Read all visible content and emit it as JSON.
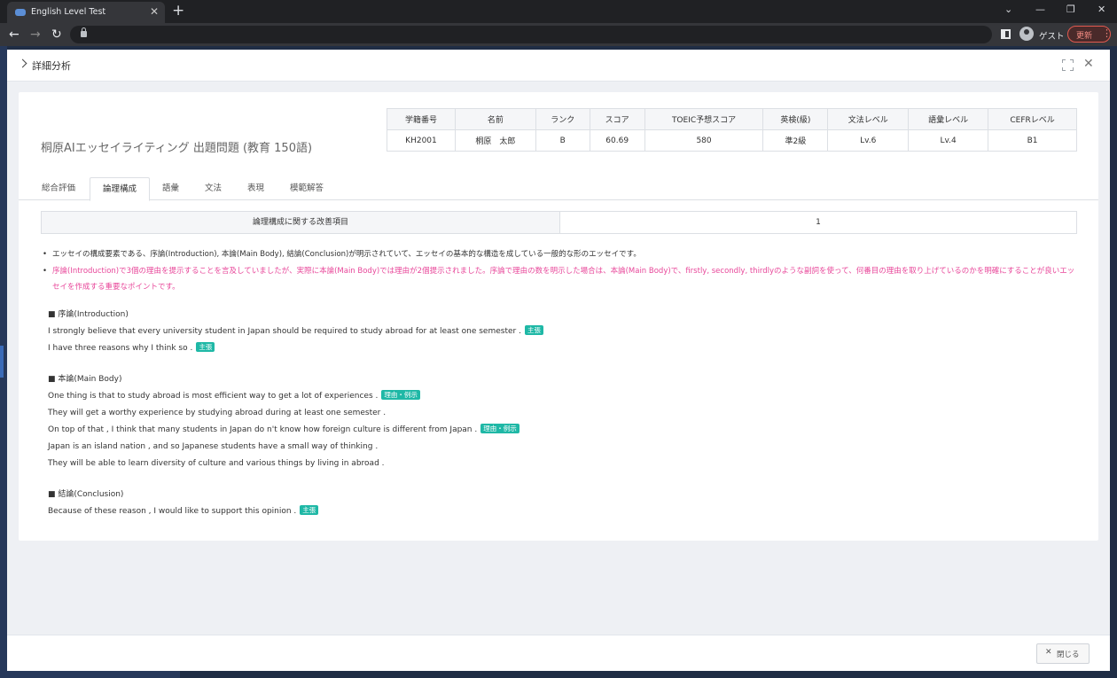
{
  "browser": {
    "tab_title": "English Level Test",
    "tab_close": "✕",
    "new_tab": "+",
    "window_controls": [
      "⌄",
      "—",
      "❐",
      "✕"
    ],
    "nav": {
      "back": "←",
      "forward": "→",
      "reload": "↻"
    },
    "profile_label": "ゲスト",
    "update_label": "更新",
    "update_menu": "⋮"
  },
  "modal": {
    "title": "詳細分析",
    "close_icon": "✕",
    "test_title": "桐原AIエッセイライティング 出題問題 (教育 150語)",
    "summary": {
      "headers": [
        "学籍番号",
        "名前",
        "ランク",
        "スコア",
        "TOEIC予想スコア",
        "英検(級)",
        "文法レベル",
        "語彙レベル",
        "CEFRレベル"
      ],
      "values": [
        "KH2001",
        "桐原　太郎",
        "B",
        "60.69",
        "580",
        "準2級",
        "Lv.6",
        "Lv.4",
        "B1"
      ]
    },
    "tabs": [
      "総合評価",
      "論理構成",
      "語彙",
      "文法",
      "表現",
      "模範解答"
    ],
    "active_tab": "論理構成",
    "improvement": {
      "label": "論理構成に関する改善項目",
      "count": "1"
    },
    "feedback": [
      {
        "text": "エッセイの構成要素である、序論(Introduction), 本論(Main Body), 結論(Conclusion)が明示されていて、エッセイの基本的な構造を成している一般的な形のエッセイです。",
        "style": "normal"
      },
      {
        "text": "序論(Introduction)で3個の理由を提示することを言及していましたが、実際に本論(Main Body)では理由が2個提示されました。序論で理由の数を明示した場合は、本論(Main Body)で、firstly, secondly, thirdlyのような副詞を使って、何番目の理由を取り上げているのかを明確にすることが良いエッセイを作成する重要なポイントです。",
        "style": "pink"
      }
    ],
    "sections": [
      {
        "heading": "■ 序論(Introduction)",
        "sentences": [
          {
            "text": "I strongly believe that every university student in Japan should be required to study abroad for at least one semester .",
            "tag": "主張"
          },
          {
            "text": "I have three reasons why I think so .",
            "tag": "主張"
          }
        ]
      },
      {
        "heading": "■ 本論(Main Body)",
        "sentences": [
          {
            "text": "One thing is that to study abroad is most efficient way to get a lot of experiences .",
            "tag": "理由・例示"
          },
          {
            "text": "They will get a worthy experience by studying abroad during at least one semester .",
            "tag": ""
          },
          {
            "text": "On top of that , I think that many students in Japan do n't know how foreign culture is different from Japan .",
            "tag": "理由・例示"
          },
          {
            "text": "Japan is an island nation , and so Japanese students have a small way of thinking .",
            "tag": ""
          },
          {
            "text": "They will be able to learn diversity of culture and various things by living in abroad .",
            "tag": ""
          }
        ]
      },
      {
        "heading": "■ 結論(Conclusion)",
        "sentences": [
          {
            "text": "Because of these reason , I would like to support this opinion .",
            "tag": "主張"
          }
        ]
      }
    ],
    "footer": {
      "close_icon": "✕",
      "close_label": "閉じる"
    }
  },
  "colors": {
    "tag": "#1fb8a6",
    "highlight_text": "#e8479a",
    "update_border": "#e25a4f"
  }
}
